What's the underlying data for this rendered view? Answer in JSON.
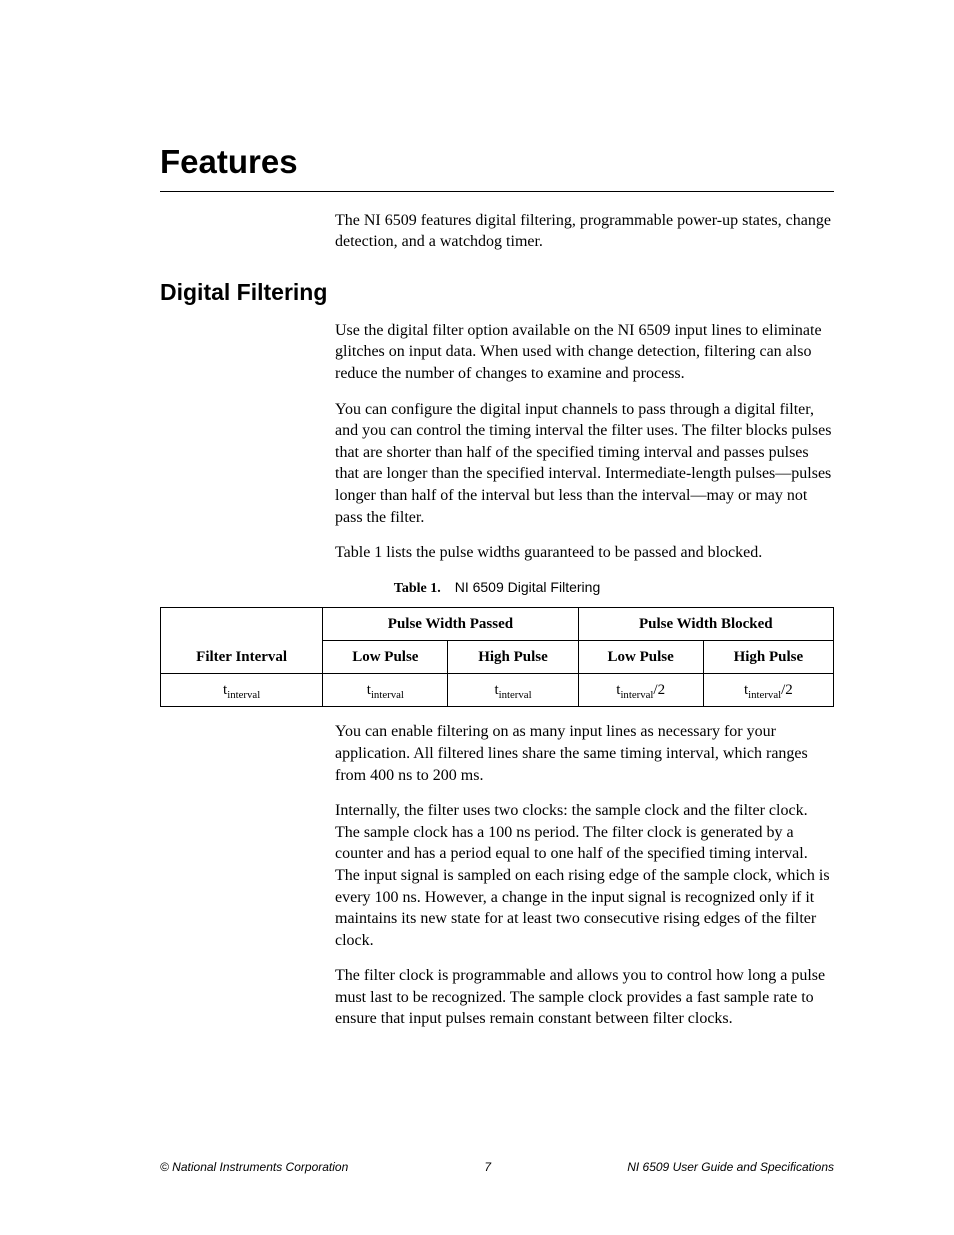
{
  "headings": {
    "h1": "Features",
    "h2": "Digital Filtering"
  },
  "paragraphs": {
    "intro": "The NI 6509 features digital filtering, programmable power-up states, change detection, and a watchdog timer.",
    "df1": "Use the digital filter option available on the NI 6509 input lines to eliminate glitches on input data. When used with change detection, filtering can also reduce the number of changes to examine and process.",
    "df2": "You can configure the digital input channels to pass through a digital filter, and you can control the timing interval the filter uses. The filter blocks pulses that are shorter than half of the specified timing interval and passes pulses that are longer than the specified interval. Intermediate-length pulses—pulses longer than half of the interval but less than the interval—may or may not pass the filter.",
    "df3": "Table 1 lists the pulse widths guaranteed to be passed and blocked.",
    "df4": "You can enable filtering on as many input lines as necessary for your application. All filtered lines share the same timing interval, which ranges from 400 ns to 200 ms.",
    "df5": "Internally, the filter uses two clocks: the sample clock and the filter clock. The sample clock has a 100 ns period. The filter clock is generated by a counter and has a period equal to one half of the specified timing interval. The input signal is sampled on each rising edge of the sample clock, which is every 100 ns. However, a change in the input signal is recognized only if it maintains its new state for at least two consecutive rising edges of the filter clock.",
    "df6": "The filter clock is programmable and allows you to control how long a pulse must last to be recognized. The sample clock provides a fast sample rate to ensure that input pulses remain constant between filter clocks."
  },
  "table": {
    "caption_label": "Table 1.",
    "caption_text": "NI 6509 Digital Filtering",
    "headers": {
      "filter_interval": "Filter Interval",
      "passed": "Pulse Width Passed",
      "blocked": "Pulse Width Blocked",
      "low": "Low Pulse",
      "high": "High Pulse"
    },
    "row": {
      "filter_interval_html": "t<sub>interval</sub>",
      "passed_low_html": "t<sub>interval</sub>",
      "passed_high_html": "t<sub>interval</sub>",
      "blocked_low_html": "t<sub>interval</sub>/2",
      "blocked_high_html": "t<sub>interval</sub>/2"
    }
  },
  "footer": {
    "left": "© National Instruments Corporation",
    "center": "7",
    "right": "NI 6509 User Guide and Specifications"
  }
}
